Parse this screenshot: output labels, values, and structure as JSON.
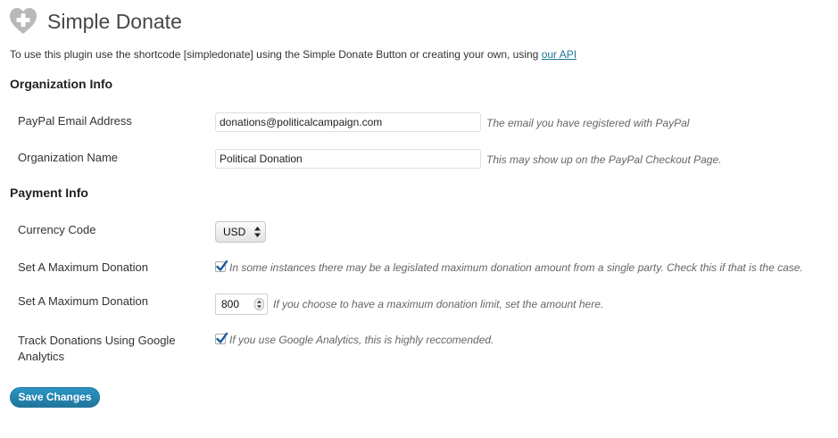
{
  "header": {
    "icon": "heart-plus-icon",
    "title": "Simple Donate"
  },
  "intro": {
    "text": "To use this plugin use the shortcode [simpledonate] using the Simple Donate Button or creating your own, using ",
    "link_label": "our API"
  },
  "organization_section": {
    "title": "Organization Info",
    "paypal_email": {
      "label": "PayPal Email Address",
      "value": "donations@politicalcampaign.com",
      "description": "The email you have registered with PayPal"
    },
    "organization_name": {
      "label": "Organization Name",
      "value": "Political Donation",
      "description": "This may show up on the PayPal Checkout Page."
    }
  },
  "payment_section": {
    "title": "Payment Info",
    "currency": {
      "label": "Currency Code",
      "selected": "USD"
    },
    "max_donation_toggle": {
      "label": "Set A Maximum Donation",
      "checked": true,
      "description": "In some instances there may be a legislated maximum donation amount from a single party. Check this if that is the case."
    },
    "max_donation_amount": {
      "label": "Set A Maximum Donation",
      "value": "800",
      "description": "If you choose to have a maximum donation limit, set the amount here."
    },
    "google_analytics": {
      "label_line1": "Track Donations Using Google",
      "label_line2": "Analytics",
      "checked": true,
      "description": "If you use Google Analytics, this is highly reccomended."
    }
  },
  "actions": {
    "save_label": "Save Changes"
  },
  "colors": {
    "link": "#21759b",
    "button": "#21759b",
    "checkmark": "#1e5e9e"
  }
}
